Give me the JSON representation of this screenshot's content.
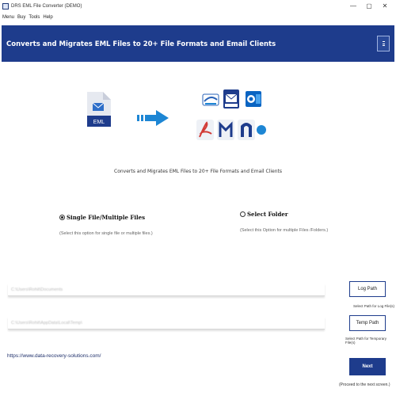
{
  "window": {
    "title": "DRS EML File Converter (DEMO)",
    "minimize": "—",
    "maximize": "▢",
    "close": "✕"
  },
  "menu": {
    "items": [
      "Menu",
      "Buy",
      "Tools",
      "Help"
    ]
  },
  "banner": {
    "title": "Converts and Migrates EML Files to 20+ File Formats and Email Clients"
  },
  "hero": {
    "file_label": "EML",
    "caption": "Converts and Migrates EML Files to 20+ File Formats and Email Clients"
  },
  "options": {
    "single": {
      "label": "Single File/Multiple Files",
      "desc": "(Select this option for single file or multiple files.)",
      "selected": true
    },
    "folder": {
      "label": "Select Folder",
      "desc": "(Select this Option for multiple Files /Folders.)",
      "selected": false
    }
  },
  "paths": {
    "log": {
      "value": "C:\\Users\\Rohit\\Documents",
      "button": "Log Path",
      "hint": "Select Path for Log File(s)"
    },
    "temp": {
      "value": "C:\\Users\\Rohit\\AppData\\Local\\Temp\\",
      "button": "Temp Path",
      "hint": "Select Path for Temporary File(s)"
    }
  },
  "footer": {
    "link": "https://www.data-recovery-solutions.com/",
    "next": "Next",
    "next_hint": "(Proceed to the next screen.)"
  },
  "colors": {
    "brand": "#1e3c8c",
    "accent_blue": "#1d86d4",
    "pdf_red": "#d23b36"
  }
}
